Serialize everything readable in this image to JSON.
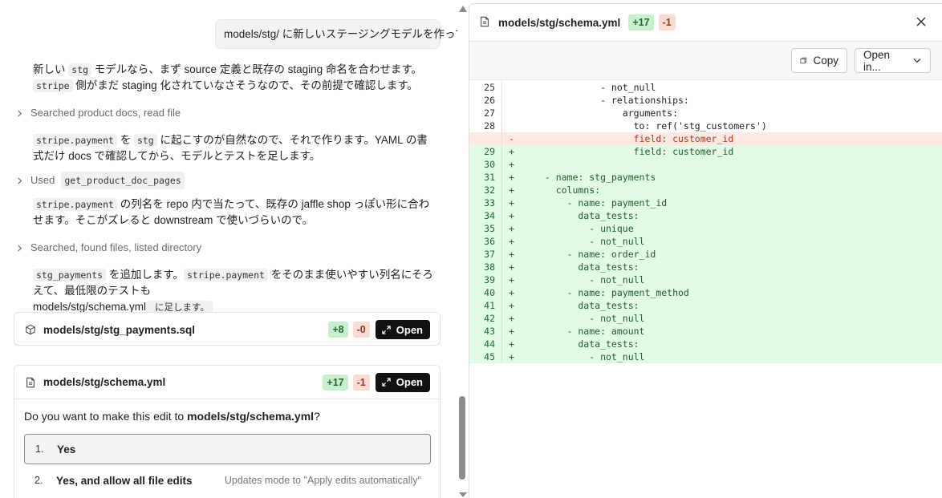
{
  "chat": {
    "user_message": "models/stg/ に新しいステージングモデルを作って",
    "p1": [
      "新しい ",
      "stg",
      " モデルなら、まず source 定義と既存の staging 命名を合わせます。",
      "stripe",
      " 側がまだ staging 化されていなさそうなので、その前提で確認します。"
    ],
    "collapse1": "Searched product docs, read file",
    "p2": [
      "stripe.payment",
      " を ",
      "stg",
      " に起こすのが自然なので、それで作ります。YAML の書式だけ docs で確認してから、モデルとテストを足します。"
    ],
    "collapse2_prefix": "Used",
    "collapse2_code": "get_product_doc_pages",
    "p3": [
      "stripe.payment",
      " の列名を repo 内で当たって、既存の jaffle shop っぽい形に合わせます。そこがズレると downstream で使いづらいので。"
    ],
    "collapse3": "Searched, found files, listed directory",
    "p4": [
      "stg_payments",
      " を追加します。",
      "stripe.payment",
      " をそのまま使いやすい列名にそろえて、最低限のテストも ",
      "models/stg/schema.yml",
      " に足します。"
    ],
    "file1": {
      "name": "models/stg/stg_payments.sql",
      "add": "+8",
      "del": "-0",
      "open": "Open"
    },
    "file2": {
      "name": "models/stg/schema.yml",
      "add": "+17",
      "del": "-1",
      "open": "Open"
    },
    "question_prefix": "Do you want to make this edit to ",
    "question_file": "models/stg/schema.yml",
    "question_suffix": "?",
    "options": [
      {
        "num": "1.",
        "label": "Yes"
      },
      {
        "num": "2.",
        "label": "Yes, and allow all file edits",
        "hint": "Updates mode to \"Apply edits automatically\""
      }
    ]
  },
  "diff": {
    "filename": "models/stg/schema.yml",
    "add": "+17",
    "del": "-1",
    "copy_label": "Copy",
    "open_in_label": "Open in...",
    "lines": [
      {
        "n": "25",
        "m": "",
        "t": "            - not_null",
        "k": "ctx"
      },
      {
        "n": "26",
        "m": "",
        "t": "            - relationships:",
        "k": "ctx"
      },
      {
        "n": "27",
        "m": "",
        "t": "                arguments:",
        "k": "ctx"
      },
      {
        "n": "28",
        "m": "",
        "t": "                  to: ref('stg_customers')",
        "k": "ctx"
      },
      {
        "n": "",
        "m": "-",
        "t": "                  field: customer_id",
        "k": "del"
      },
      {
        "n": "29",
        "m": "+",
        "t": "                  field: customer_id",
        "k": "add"
      },
      {
        "n": "30",
        "m": "+",
        "t": "",
        "k": "add"
      },
      {
        "n": "31",
        "m": "+",
        "t": "  - name: stg_payments",
        "k": "add"
      },
      {
        "n": "32",
        "m": "+",
        "t": "    columns:",
        "k": "add"
      },
      {
        "n": "33",
        "m": "+",
        "t": "      - name: payment_id",
        "k": "add"
      },
      {
        "n": "34",
        "m": "+",
        "t": "        data_tests:",
        "k": "add"
      },
      {
        "n": "35",
        "m": "+",
        "t": "          - unique",
        "k": "add"
      },
      {
        "n": "36",
        "m": "+",
        "t": "          - not_null",
        "k": "add"
      },
      {
        "n": "37",
        "m": "+",
        "t": "      - name: order_id",
        "k": "add"
      },
      {
        "n": "38",
        "m": "+",
        "t": "        data_tests:",
        "k": "add"
      },
      {
        "n": "39",
        "m": "+",
        "t": "          - not_null",
        "k": "add"
      },
      {
        "n": "40",
        "m": "+",
        "t": "      - name: payment_method",
        "k": "add"
      },
      {
        "n": "41",
        "m": "+",
        "t": "        data_tests:",
        "k": "add"
      },
      {
        "n": "42",
        "m": "+",
        "t": "          - not_null",
        "k": "add"
      },
      {
        "n": "43",
        "m": "+",
        "t": "      - name: amount",
        "k": "add"
      },
      {
        "n": "44",
        "m": "+",
        "t": "        data_tests:",
        "k": "add"
      },
      {
        "n": "45",
        "m": "+",
        "t": "          - not_null",
        "k": "add"
      }
    ]
  }
}
